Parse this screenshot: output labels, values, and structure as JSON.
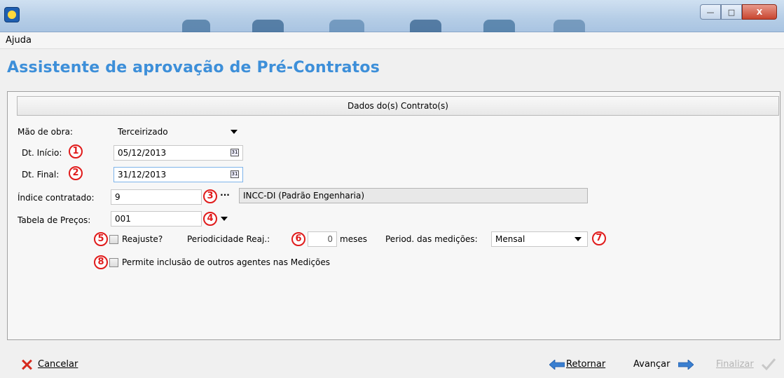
{
  "window": {
    "minimize_glyph": "—",
    "maximize_glyph": "□",
    "close_glyph": "X"
  },
  "menu": {
    "items": [
      "Ajuda"
    ]
  },
  "page": {
    "title": "Assistente de aprovação de Pré-Contratos"
  },
  "section": {
    "header": "Dados do(s) Contrato(s)"
  },
  "form": {
    "mao_de_obra": {
      "label": "Mão de obra:",
      "value": "Terceirizado"
    },
    "dt_inicio": {
      "label": "Dt. Início:",
      "value": "05/12/2013",
      "marker": "1"
    },
    "dt_final": {
      "label": "Dt. Final:",
      "value": "31/12/2013",
      "marker": "2"
    },
    "indice": {
      "label": "Índice contratado:",
      "value": "9",
      "marker": "3",
      "description": "INCC-DI (Padrão Engenharia)",
      "ellipsis": "···"
    },
    "tabela": {
      "label": "Tabela de Preços:",
      "value": "001",
      "marker": "4"
    },
    "reajuste": {
      "label": "Reajuste?",
      "checked": false,
      "marker": "5"
    },
    "periodicidade": {
      "label": "Periodicidade Reaj.:",
      "value": "0",
      "unit": "meses",
      "marker": "6"
    },
    "period_medicoes": {
      "label": "Period. das medições:",
      "value": "Mensal",
      "marker": "7"
    },
    "permite_inclusao": {
      "label": "Permite inclusão de outros agentes nas Medições",
      "checked": false,
      "marker": "8"
    }
  },
  "footer": {
    "cancel": "Cancelar",
    "back": "Retornar",
    "next": "Avançar",
    "finish": "Finalizar"
  },
  "colors": {
    "title": "#3d8fd9",
    "marker": "#e01b1b",
    "cancel_icon": "#d62a1e",
    "arrow": "#3a7fd0"
  }
}
